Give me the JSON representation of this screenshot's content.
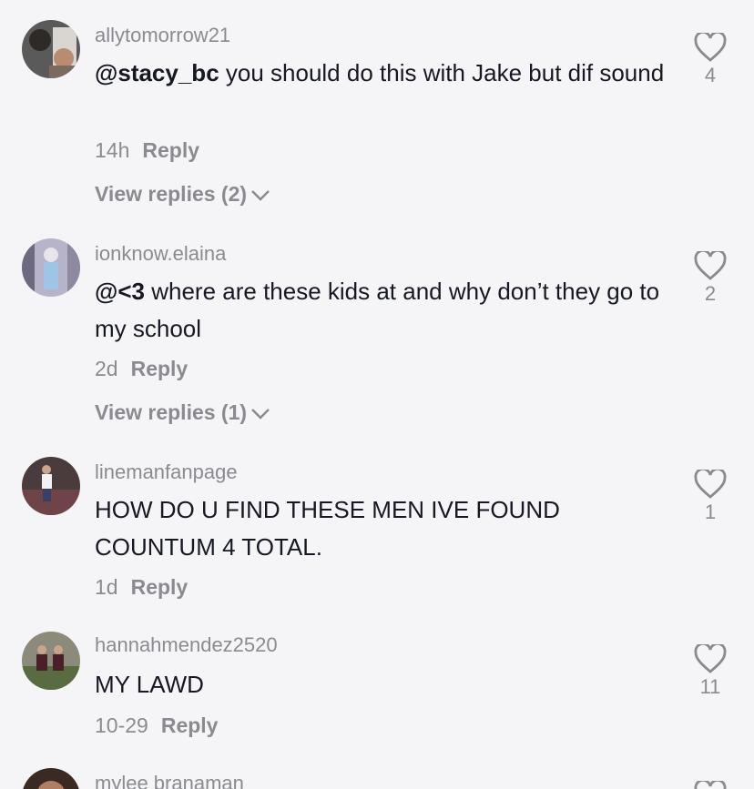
{
  "comments": [
    {
      "username": "allytomorrow21",
      "mention": "@stacy_bc",
      "text": " you should do this with Jake but dif sound",
      "time": "14h",
      "reply_label": "Reply",
      "view_replies": "View replies (2)",
      "likes": "4"
    },
    {
      "username": "ionknow.elaina",
      "mention": "@<3",
      "text": " where are these kids at and why don’t they go to my school",
      "time": "2d",
      "reply_label": "Reply",
      "view_replies": "View replies (1)",
      "likes": "2"
    },
    {
      "username": "linemanfanpage",
      "mention": "",
      "text": "HOW DO U FIND THESE MEN IVE FOUND COUNTUM 4 TOTAL.",
      "time": "1d",
      "reply_label": "Reply",
      "likes": "1"
    },
    {
      "username": "hannahmendez2520",
      "mention": "",
      "text": "MY LAWD",
      "time": "10-29",
      "reply_label": "Reply",
      "likes": "11"
    },
    {
      "username": "mylee branaman"
    }
  ],
  "colors": {
    "background": "#f5f5f7",
    "primary_text": "#161823",
    "secondary_text": "#8a8b91"
  },
  "icons": {
    "like": "heart-outline-icon",
    "expand": "chevron-down-icon"
  }
}
